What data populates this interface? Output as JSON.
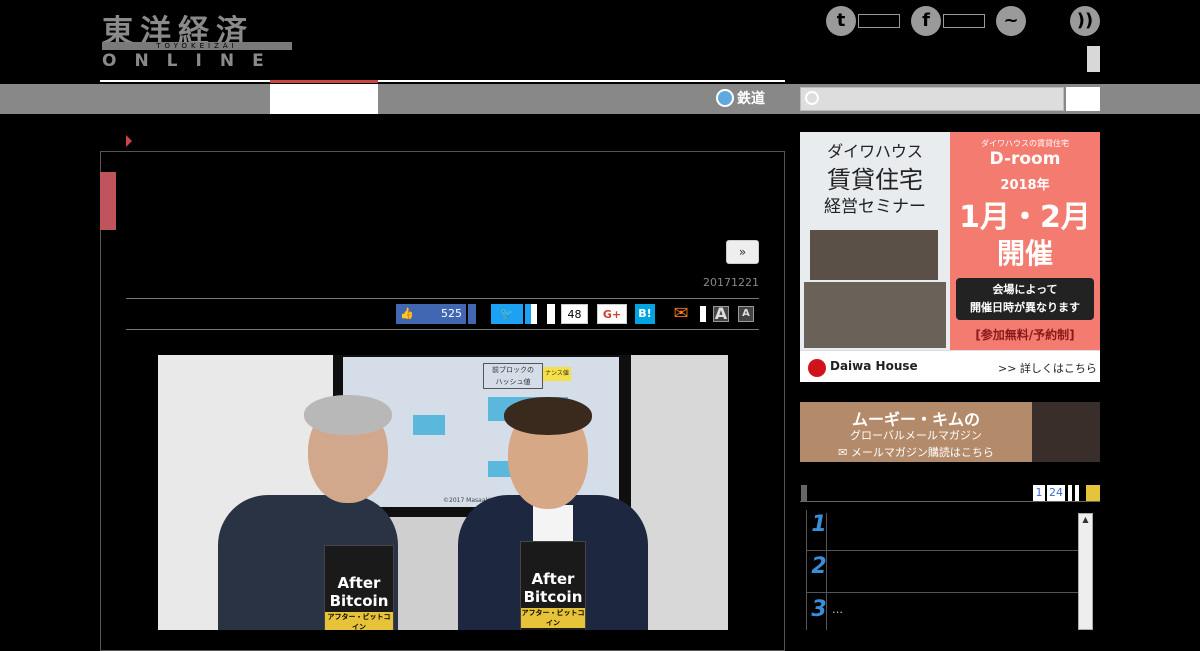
{
  "header": {
    "logo_kanji": "東洋経済",
    "logo_romaji": "TOYOKEIZAI",
    "logo_online": "ONLINE",
    "social_icons": [
      "twitter-icon",
      "facebook-icon",
      "messenger-icon",
      "rss-icon"
    ]
  },
  "nav": {
    "rail_label": "鉄道",
    "search_placeholder": ""
  },
  "article": {
    "more_label": "»",
    "date": "20171221",
    "share": {
      "facebook_count": "525",
      "pocket_count": "48",
      "gplus_label": "G+",
      "hatena_label": "B!",
      "font_large_label": "A",
      "font_small_label": "A"
    },
    "photo": {
      "slide_title_1": "前ブロックの",
      "slide_title_2": "ハッシュ値",
      "slide_nonce": "ナンス値",
      "slide_footer": "©2017 Masaaki Nagano",
      "book_title_1": "After",
      "book_title_2": "Bitcoin",
      "book_subtitle": "アフター・ビットコイン"
    }
  },
  "sidebar": {
    "ad1": {
      "brand_top": "ダイワハウス",
      "headline_1": "賃貸住宅",
      "headline_2": "経営セミナー",
      "right_caption": "ダイワハウスの賃貸住宅",
      "droom": "D-room",
      "year": "2018年",
      "months": "1月・2月",
      "held": "開催",
      "venue_note_1": "会場によって",
      "venue_note_2": "開催日時が異なります",
      "free_note": "[参加無料/予約制]",
      "logo_text": "Daiwa House",
      "details_link": ">> 詳しくはこちら"
    },
    "ad2": {
      "line1": "ムーギー・キムの",
      "line2": "グローバルメールマガジン",
      "line3": "メールマガジン購読はこちら"
    },
    "ranking": {
      "pages": [
        "1",
        "24"
      ],
      "items": [
        {
          "rank": "1",
          "text": ""
        },
        {
          "rank": "2",
          "text": ""
        },
        {
          "rank": "3",
          "text": "…"
        }
      ]
    }
  }
}
